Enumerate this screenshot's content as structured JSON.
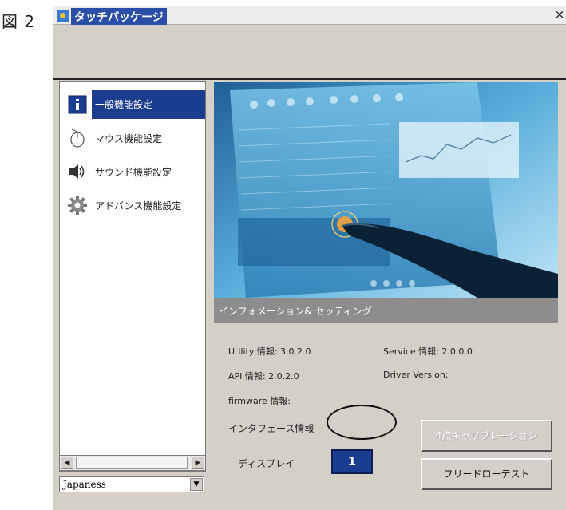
{
  "figure_label": "図 2",
  "window": {
    "title": "タッチパッケージ",
    "close_label": "×"
  },
  "sidebar": {
    "items": [
      {
        "label": "一般機能設定",
        "icon": "info-icon",
        "selected": true
      },
      {
        "label": "マウス機能設定",
        "icon": "mouse-icon",
        "selected": false
      },
      {
        "label": "サウンド機能設定",
        "icon": "speaker-icon",
        "selected": false
      },
      {
        "label": "アドバンス機能設定",
        "icon": "gear-icon",
        "selected": false
      }
    ],
    "scroll_left": "◀",
    "scroll_right": "▶",
    "language_value": "Japaness",
    "dropdown_arrow": "▼"
  },
  "main": {
    "banner_caption": "インフォメーション& セッティング",
    "utility_info": "Utility 情報: 3.0.2.0",
    "service_info": "Service 情報: 2.0.0.0",
    "api_info": "API 情報: 2.0.2.0",
    "driver_version": "Driver Version:",
    "firmware_info": "firmware 情報:",
    "interface_info": "インタフェース情報",
    "display_label": "ディスプレイ",
    "display_value": "1",
    "calibration_button": "4点キャリブレーション",
    "free_draw_button": "フリードローテスト"
  },
  "colors": {
    "selection": "#1b3d8f",
    "window_bg": "#d4d0c8",
    "caption_strip": "#8d8d8d"
  }
}
